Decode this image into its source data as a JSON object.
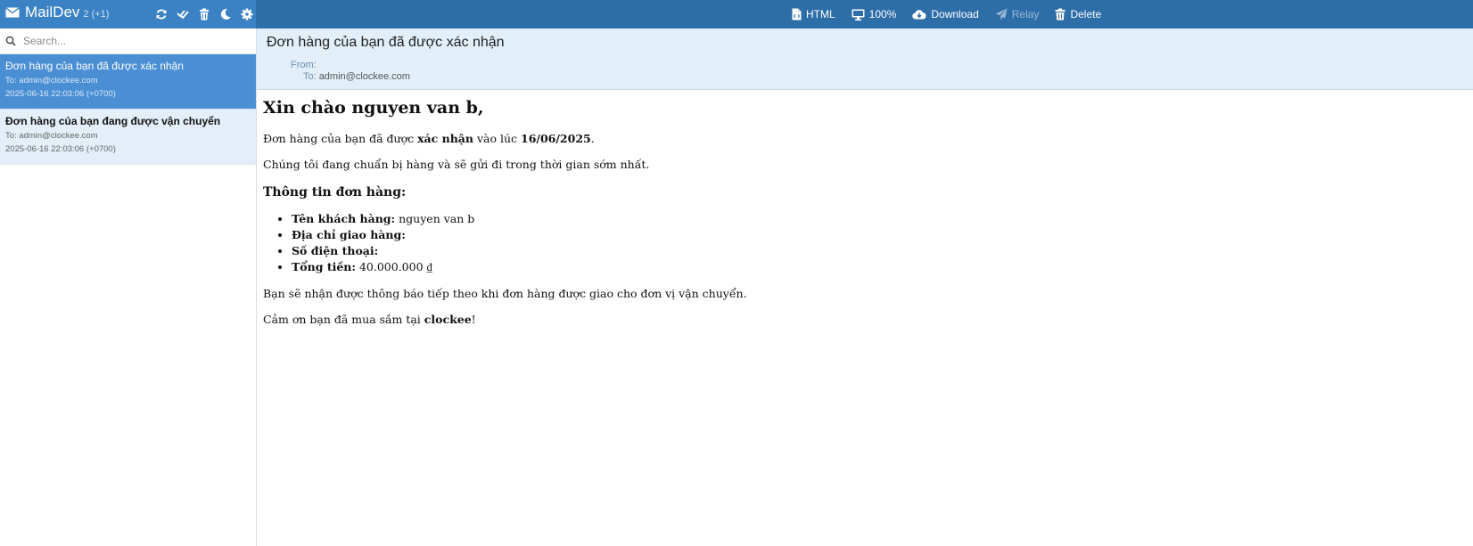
{
  "app": {
    "title": "MailDev",
    "counts": "2 (+1)"
  },
  "search": {
    "placeholder": "Search..."
  },
  "toolbar": {
    "html": "HTML",
    "zoom": "100%",
    "download": "Download",
    "relay": "Relay",
    "delete": "Delete"
  },
  "emails": [
    {
      "subject": "Đơn hàng của bạn đã được xác nhận",
      "to": "To: admin@clockee.com",
      "date": "2025-06-16 22:03:06 (+0700)"
    },
    {
      "subject": "Đơn hàng của bạn đang được vận chuyển",
      "to": "To: admin@clockee.com",
      "date": "2025-06-16 22:03:06 (+0700)"
    }
  ],
  "message": {
    "subject": "Đơn hàng của bạn đã được xác nhận",
    "from_label": "From:",
    "to_label": "To:",
    "to": "admin@clockee.com",
    "greeting": "Xin chào nguyen van b,",
    "p1": {
      "a": "Đơn hàng của bạn đã được ",
      "b": "xác nhận",
      "c": " vào lúc ",
      "d": "16/06/2025",
      "e": "."
    },
    "p2": "Chúng tôi đang chuẩn bị hàng và sẽ gửi đi trong thời gian sớm nhất.",
    "info_heading": "Thông tin đơn hàng:",
    "info": [
      {
        "label": "Tên khách hàng:",
        "value": " nguyen van b"
      },
      {
        "label": "Địa chỉ giao hàng:",
        "value": ""
      },
      {
        "label": "Số điện thoại:",
        "value": ""
      },
      {
        "label": "Tổng tiền:",
        "value": " 40.000.000 ₫"
      }
    ],
    "p3": "Bạn sẽ nhận được thông báo tiếp theo khi đơn hàng được giao cho đơn vị vận chuyển.",
    "p4": {
      "a": "Cảm ơn bạn đã mua sắm tại ",
      "b": "clockee",
      "c": "!"
    }
  },
  "colors": {
    "topbar": "#2e6ea8",
    "brand_area": "#3b82c4",
    "selected_item": "#4a8fd4",
    "header_bg": "#e2eef8"
  }
}
